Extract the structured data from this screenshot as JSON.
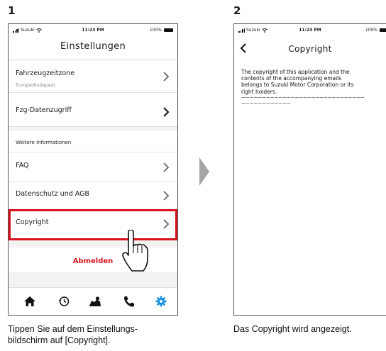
{
  "steps": [
    {
      "number": "1",
      "status": {
        "carrier": "Suzuki",
        "time": "11:23 PM",
        "battery": "100%"
      },
      "title": "Einstellungen",
      "rows": [
        {
          "label": "Fahrzeugzeitzone",
          "sub": "Europe/Budapest"
        },
        {
          "label": "Fzg-Datenzugriff"
        }
      ],
      "section_label": "Weitere Informationen",
      "info_rows": [
        {
          "label": "FAQ"
        },
        {
          "label": "Datenschutz und AGB"
        },
        {
          "label": "Copyright"
        }
      ],
      "logout_label": "Abmelden",
      "tabs": [
        "home-icon",
        "history-icon",
        "map-icon",
        "phone-icon",
        "settings-icon"
      ],
      "caption_lines": [
        "Tippen Sie auf dem Einstellungs-",
        "bildschirm auf [Copyright]."
      ]
    },
    {
      "number": "2",
      "status": {
        "carrier": "Suzuki",
        "time": "11:23 PM",
        "battery": "100%"
      },
      "title": "Copyright",
      "text_lines": [
        "The copyright of this application and the",
        "contents of the accompanying emails",
        "belongs to Suzuki Motor Corporation or its",
        "right holders."
      ],
      "tilde_lines": [
        "~~~~~~~~~~~~~~~~~~~~~~~~~~~~~~",
        "~~~~~~~~~~~~"
      ],
      "caption": "Das Copyright wird angezeigt."
    }
  ],
  "colors": {
    "accent": "#d6131d",
    "settings_tab": "#1a8fe0"
  }
}
